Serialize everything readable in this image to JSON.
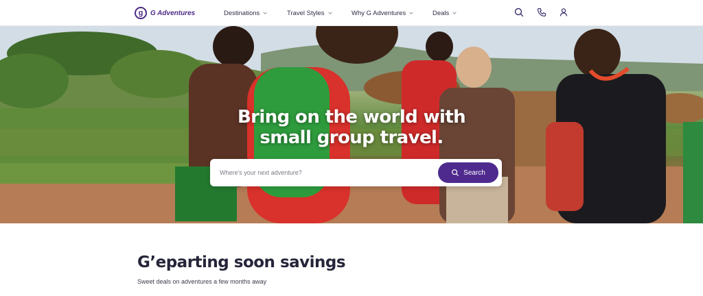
{
  "brand": {
    "name": "G Adventures",
    "mark": "g",
    "color": "#4c2a85"
  },
  "nav": {
    "items": [
      {
        "label": "Destinations"
      },
      {
        "label": "Travel Styles"
      },
      {
        "label": "Why G Adventures"
      },
      {
        "label": "Deals"
      }
    ]
  },
  "utility_icons": [
    "search-icon",
    "phone-icon",
    "user-icon"
  ],
  "hero": {
    "title": "Bring on the world with small group travel.",
    "search": {
      "placeholder": "Where's your next adventure?",
      "button_label": "Search"
    }
  },
  "section": {
    "title": "G’eparting soon savings",
    "subtitle": "Sweet deals on adventures a few months away"
  },
  "colors": {
    "accent": "#4e2a8e",
    "text": "#25253a"
  }
}
